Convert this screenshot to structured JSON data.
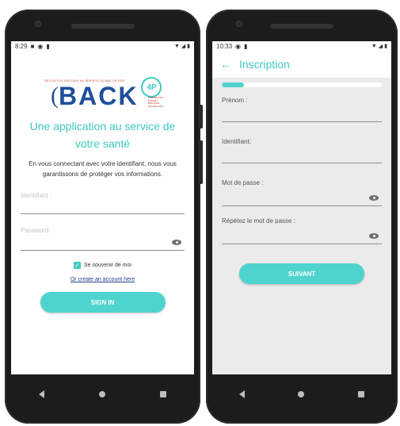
{
  "left": {
    "status": {
      "time": "8:29"
    },
    "logo": {
      "tagline": "DES OUTILS DIGITAUX AU SERVICE DU MAL DE DOS",
      "word": "BACK",
      "badge": "4P",
      "sub": [
        "PRÉVENTION",
        "PATIENT",
        "BIOLOGIE",
        "PROJECTION"
      ]
    },
    "title_line1": "Une application au service de",
    "title_line2": "votre santé",
    "description_line1": "En vous connectant avec votre identifiant, nous vous",
    "description_line2": "garantissons de protéger vos informations.",
    "identifiant_label": "Identifiant :",
    "password_label": "Password:",
    "remember_label": "Se souvenir de moi",
    "remember_checked": true,
    "create_account_link": "Or create an account here",
    "signin_button": "SIGN IN"
  },
  "right": {
    "status": {
      "time": "10:33"
    },
    "header_title": "Inscription",
    "back_icon": "arrow-left-icon",
    "progress": 0.14,
    "fields": {
      "prenom": "Prénom :",
      "identifiant": "Identifiant:",
      "password": "Mot de passe :",
      "repeat_password": "Répétez le mot de passe :"
    },
    "next_button": "SUIVANT"
  },
  "colors": {
    "accent": "#3fc9c3",
    "button": "#4fd3cf",
    "logo_blue": "#1f4f9c",
    "link": "#1f3f8f",
    "phone_body": "#1c1c1c"
  }
}
